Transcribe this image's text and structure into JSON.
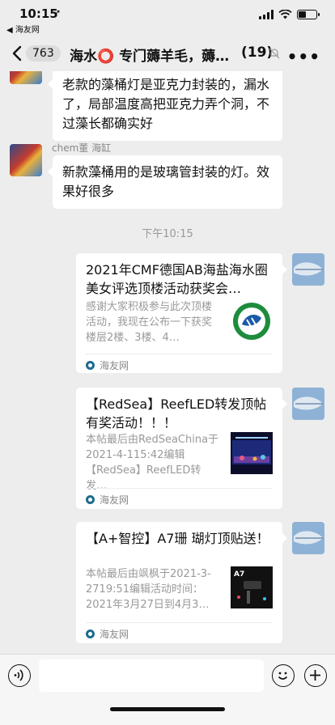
{
  "status_bar": {
    "time": "10:15",
    "back_app": "◀ 海友网",
    "battery_level": 0.45
  },
  "nav": {
    "unread_count": "763",
    "chat_title": "海水⭕ 专门薅羊毛，薅…",
    "member_count": "(19)"
  },
  "messages": {
    "msg1_text": "老款的藻桶灯是亚克力封装的，漏水了，局部温度高把亚克力弄个洞，不过藻长都确实好",
    "msg2_sender": "chem董 海缸",
    "msg2_text": "新款藻桶用的是玻璃管封装的灯。效果好很多",
    "timestamp": "下午10:15"
  },
  "cards": [
    {
      "title": "2021年CMF德国AB海盐海水圈美女评选顶楼活动获奖会…",
      "desc": "感谢大家积极参与此次顶楼活动，我现在公布一下获奖楼层2楼、3楼、4…",
      "source": "海友网"
    },
    {
      "title": "【RedSea】ReefLED转发顶帖有奖活动！！！",
      "desc": "本帖最后由RedSeaChina于2021-4-115:42编辑【RedSea】ReefLED转发…",
      "source": "海友网"
    },
    {
      "title": "【A+智控】A7珊 瑚灯顶贴送！",
      "desc": "本帖最后由飒枫于2021-3-2719:51编辑活动时间：2021年3月27日到4月3…",
      "source": "海友网",
      "thumb_label": "A7"
    }
  ]
}
